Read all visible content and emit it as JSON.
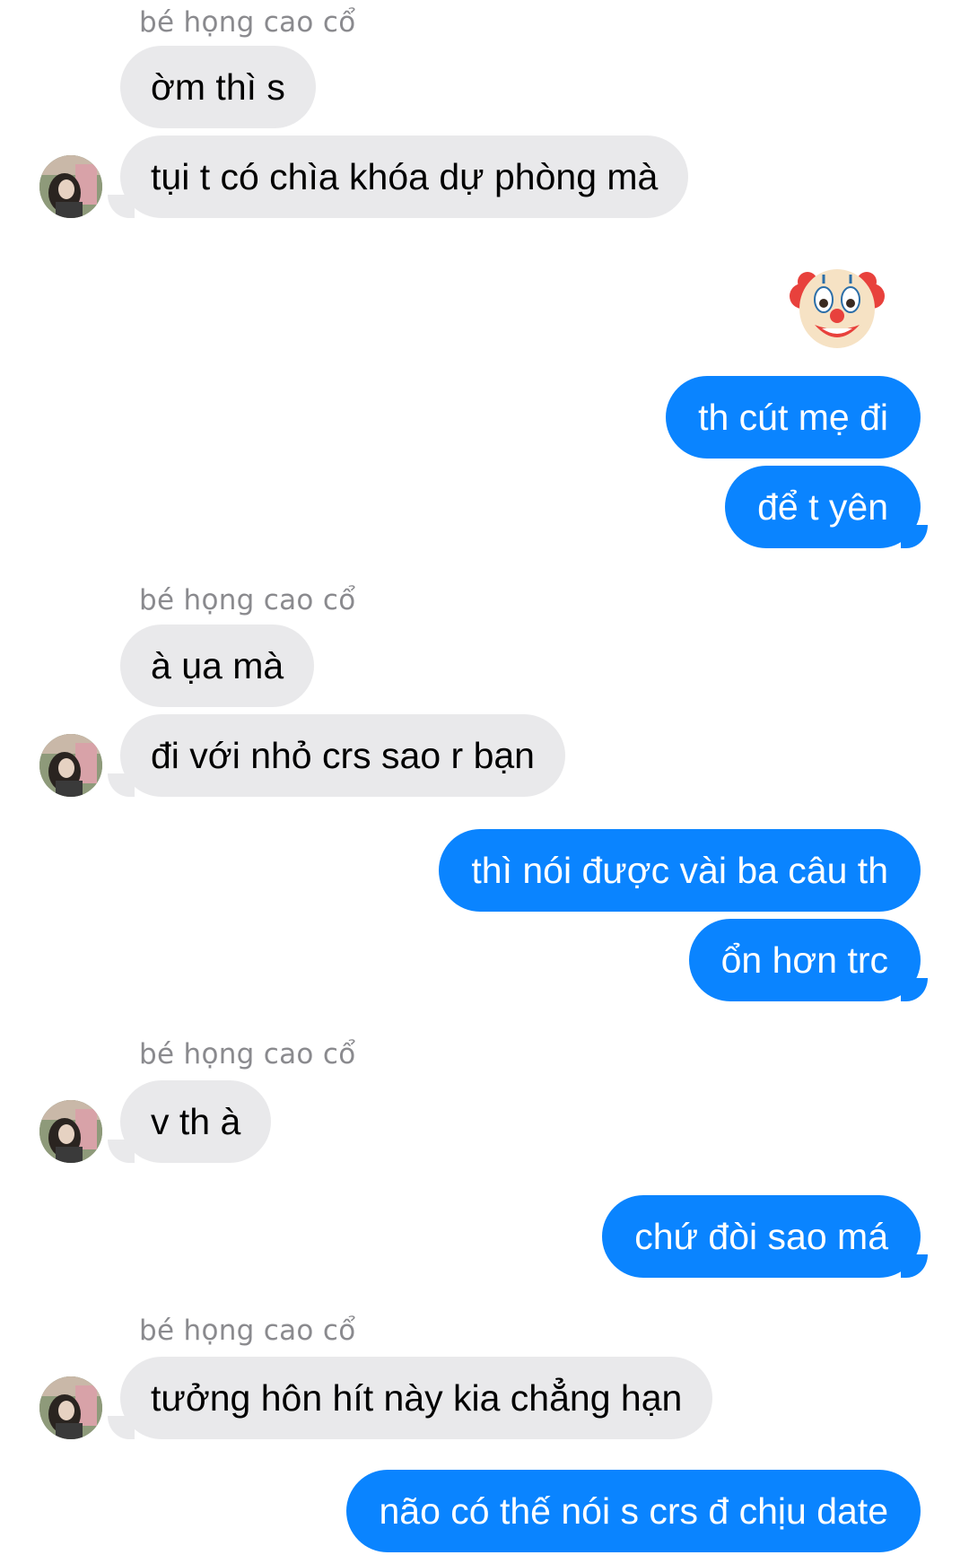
{
  "sender_name": "bé họng cao cổ",
  "colors": {
    "incoming_bubble": "#e9e9eb",
    "outgoing_bubble": "#0a84ff",
    "sender_name": "#8a8a8e"
  },
  "messages": [
    {
      "side": "incoming",
      "text": "ờm thì s"
    },
    {
      "side": "incoming",
      "text": "tụi t có chìa khóa dự phòng mà"
    },
    {
      "side": "outgoing",
      "emoji": "clown-face-icon"
    },
    {
      "side": "outgoing",
      "text": "th cút mẹ đi"
    },
    {
      "side": "outgoing",
      "text": "để t yên"
    },
    {
      "side": "incoming",
      "text": "à ụa mà"
    },
    {
      "side": "incoming",
      "text": "đi với nhỏ crs sao r bạn"
    },
    {
      "side": "outgoing",
      "text": "thì nói được vài ba câu th"
    },
    {
      "side": "outgoing",
      "text": "ổn hơn trc"
    },
    {
      "side": "incoming",
      "text": "v th à"
    },
    {
      "side": "outgoing",
      "text": "chứ đòi sao má"
    },
    {
      "side": "incoming",
      "text": "tưởng hôn hít này kia chẳng hạn"
    },
    {
      "side": "outgoing",
      "text": "não có thế nói s crs đ chịu date"
    }
  ]
}
